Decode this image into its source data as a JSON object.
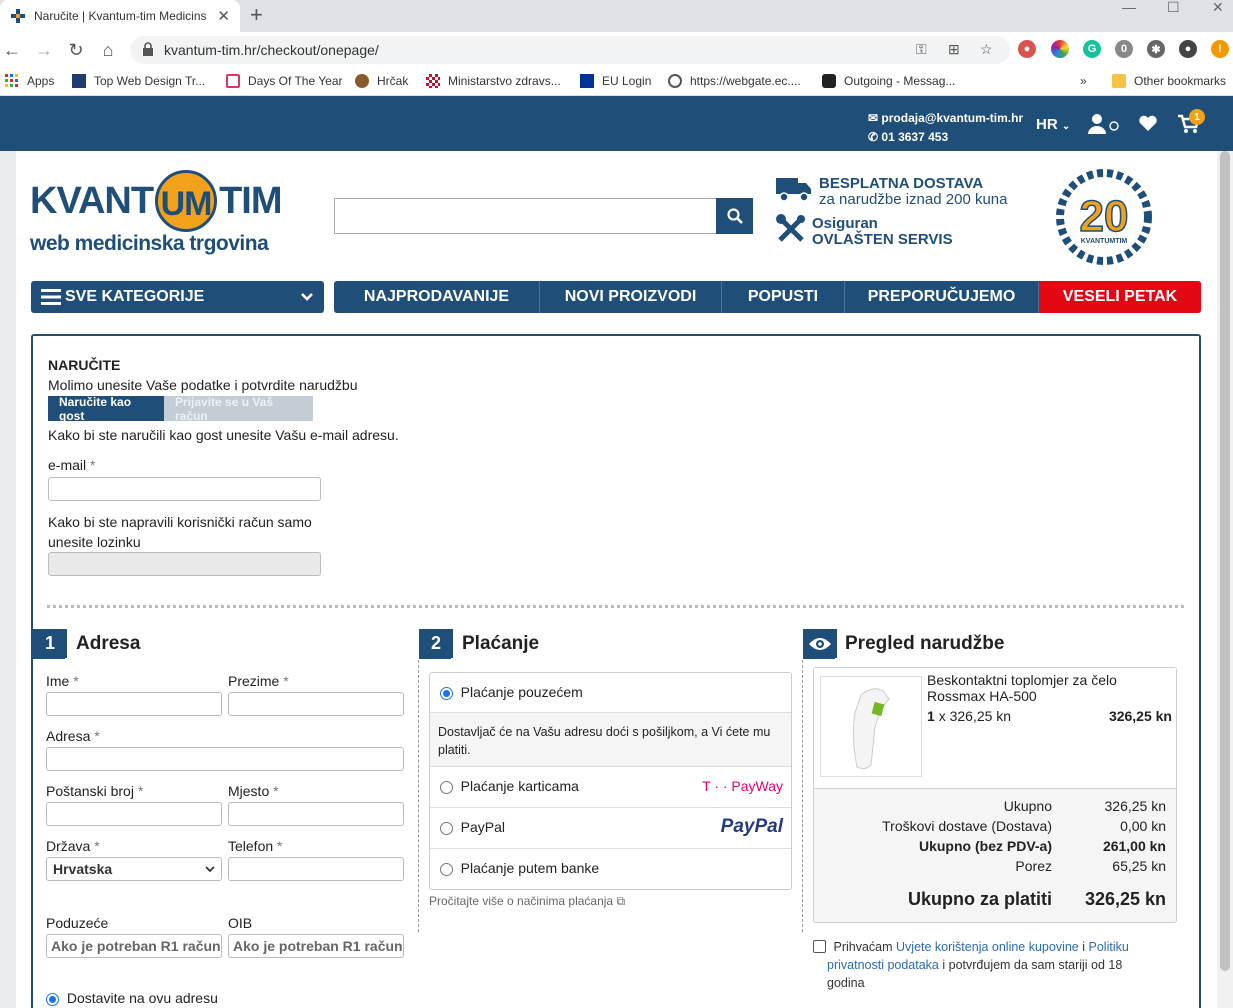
{
  "browser": {
    "tab_title": "Naručite | Kvantum-tim Medicins",
    "url": "kvantum-tim.hr/checkout/onepage/",
    "ext_badge": "0",
    "bookmarks": [
      {
        "label": "Apps"
      },
      {
        "label": "Top Web Design Tr..."
      },
      {
        "label": "Days Of The Year"
      },
      {
        "label": "Hrčak"
      },
      {
        "label": "Ministarstvo zdravs..."
      },
      {
        "label": "EU Login"
      },
      {
        "label": "https://webgate.ec...."
      },
      {
        "label": "Outgoing - Messag..."
      }
    ],
    "more_bookmarks": "»",
    "other_bookmarks": "Other bookmarks"
  },
  "topbar": {
    "email": "prodaja@kvantum-tim.hr",
    "phone": "01 3637 453",
    "lang": "HR",
    "cart_count": "1"
  },
  "logo": {
    "left": "KVANT",
    "mid": "UM",
    "right": "TIM",
    "sub": "web medicinska trgovina",
    "badge_number": "20",
    "badge_text": "KVANTUMTIM"
  },
  "promos": {
    "delivery_title": "BESPLATNA DOSTAVA",
    "delivery_sub": "za narudžbe iznad 200 kuna",
    "service_title": "Osiguran",
    "service_sub": "OVLAŠTEN SERVIS"
  },
  "nav": {
    "categories": "SVE KATEGORIJE",
    "items": [
      "NAJPRODAVANIJE",
      "NOVI PROIZVODI",
      "POPUSTI",
      "PREPORUČUJEMO",
      "VESELI PETAK"
    ]
  },
  "order": {
    "heading": "NARUČITE",
    "intro": "Molimo unesite Vaše podatke i potvrdite narudžbu",
    "tab_guest": "Naručite kao gost",
    "tab_login": "Prijavite se u Vaš račun",
    "guest_info": "Kako bi ste naručili kao gost unesite Vašu e-mail adresu.",
    "email_label": "e-mail",
    "required": "*",
    "password_info_1": "Kako bi ste napravili korisnički račun samo",
    "password_info_2": "unesite lozinku"
  },
  "address": {
    "num": "1",
    "title": "Adresa",
    "first_name": "Ime",
    "last_name": "Prezime",
    "street": "Adresa",
    "postal": "Poštanski broj",
    "city": "Mjesto",
    "country": "Država",
    "country_value": "Hrvatska",
    "phone": "Telefon",
    "company": "Poduzeće",
    "oib": "OIB",
    "company_placeholder": "Ako je potreban R1 račun",
    "oib_placeholder": "Ako je potreban R1 račun",
    "ship_here": "Dostavite na ovu adresu"
  },
  "payment": {
    "num": "2",
    "title": "Plaćanje",
    "cod": "Plaćanje pouzećem",
    "cod_desc": "Dostavljač će na Vašu adresu doći s pošiljkom, a Vi ćete mu platiti.",
    "card": "Plaćanje karticama",
    "payway": "T · · PayWay",
    "paypal": "PayPal",
    "paypal_logo": "PayPal",
    "bank": "Plaćanje putem banke",
    "more_info": "Pročitajte više o načinima plaćanja"
  },
  "review": {
    "title": "Pregled narudžbe",
    "product_name_1": "Beskontaktni toplomjer za čelo",
    "product_name_2": "Rossmax HA-500",
    "qty": "1",
    "qty_sep": "x 326,25 kn",
    "line_total": "326,25 kn",
    "rows": [
      {
        "label": "Ukupno",
        "value": "326,25 kn"
      },
      {
        "label": "Troškovi dostave (Dostava)",
        "value": "0,00 kn"
      },
      {
        "label": "Ukupno (bez PDV-a)",
        "value": "261,00 kn"
      },
      {
        "label": "Porez",
        "value": "65,25 kn"
      }
    ],
    "grand_label": "Ukupno za platiti",
    "grand_value": "326,25 kn",
    "terms_1": "Prihvaćam",
    "terms_link_1": "Uvjete korištenja online kupovine",
    "terms_2": "i",
    "terms_link_2a": "Politiku",
    "terms_link_2b": "privatnosti podataka",
    "terms_3": "i potvrđujem da sam stariji od 18",
    "terms_4": "godina"
  },
  "colors": {
    "brand": "#1f4e79",
    "accent": "#f2a21a",
    "red": "#e30613"
  }
}
